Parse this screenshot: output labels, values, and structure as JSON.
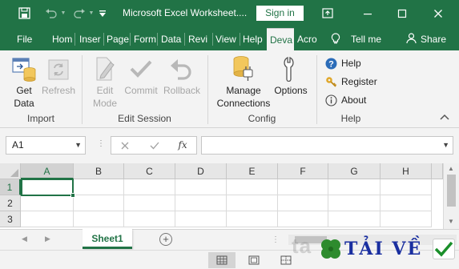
{
  "window": {
    "title": "Microsoft Excel Worksheet....",
    "sign_in": "Sign in",
    "colors": {
      "brand": "#217346",
      "ribbon_bg": "#f3f3f3",
      "header_bg": "#e6e6e6",
      "selection": "#217346"
    }
  },
  "quick_access": {
    "icons": [
      "save-icon",
      "undo-icon",
      "redo-icon",
      "customize-icon"
    ]
  },
  "window_controls": {
    "icons": [
      "ribbon-display-icon",
      "minimize-icon",
      "maximize-icon",
      "close-icon"
    ]
  },
  "tabs": {
    "items": [
      {
        "label": "File"
      },
      {
        "label": "Hom"
      },
      {
        "label": "Inser"
      },
      {
        "label": "Page"
      },
      {
        "label": "Form"
      },
      {
        "label": "Data"
      },
      {
        "label": "Revi"
      },
      {
        "label": "View"
      },
      {
        "label": "Help"
      },
      {
        "label": "Deva"
      },
      {
        "label": "Acro"
      }
    ],
    "active": "Deva",
    "tell_me": "Tell me",
    "share": "Share"
  },
  "ribbon": {
    "get_data": {
      "line1": "Get",
      "line2": "Data"
    },
    "refresh": {
      "label": "Refresh"
    },
    "edit_mode": {
      "line1": "Edit",
      "line2": "Mode"
    },
    "commit": {
      "label": "Commit"
    },
    "rollback": {
      "label": "Rollback"
    },
    "manage": {
      "line1": "Manage",
      "line2": "Connections"
    },
    "options": {
      "label": "Options"
    },
    "help_items": [
      {
        "label": "Help",
        "icon": "help-icon"
      },
      {
        "label": "Register",
        "icon": "key-icon"
      },
      {
        "label": "About",
        "icon": "info-icon"
      }
    ],
    "groups": {
      "import": "Import",
      "edit_session": "Edit Session",
      "config": "Config",
      "help": "Help"
    }
  },
  "formula_bar": {
    "name_box": "A1",
    "fx": "fx",
    "formula": ""
  },
  "grid": {
    "columns": [
      "A",
      "B",
      "C",
      "D",
      "E",
      "F",
      "G",
      "H"
    ],
    "rows": [
      "1",
      "2",
      "3"
    ],
    "active_cell": "A1"
  },
  "sheets": {
    "tabs": [
      "Sheet1"
    ],
    "active": "Sheet1"
  },
  "watermark": {
    "ghost": "ta",
    "text": "TẢI VỀ"
  }
}
